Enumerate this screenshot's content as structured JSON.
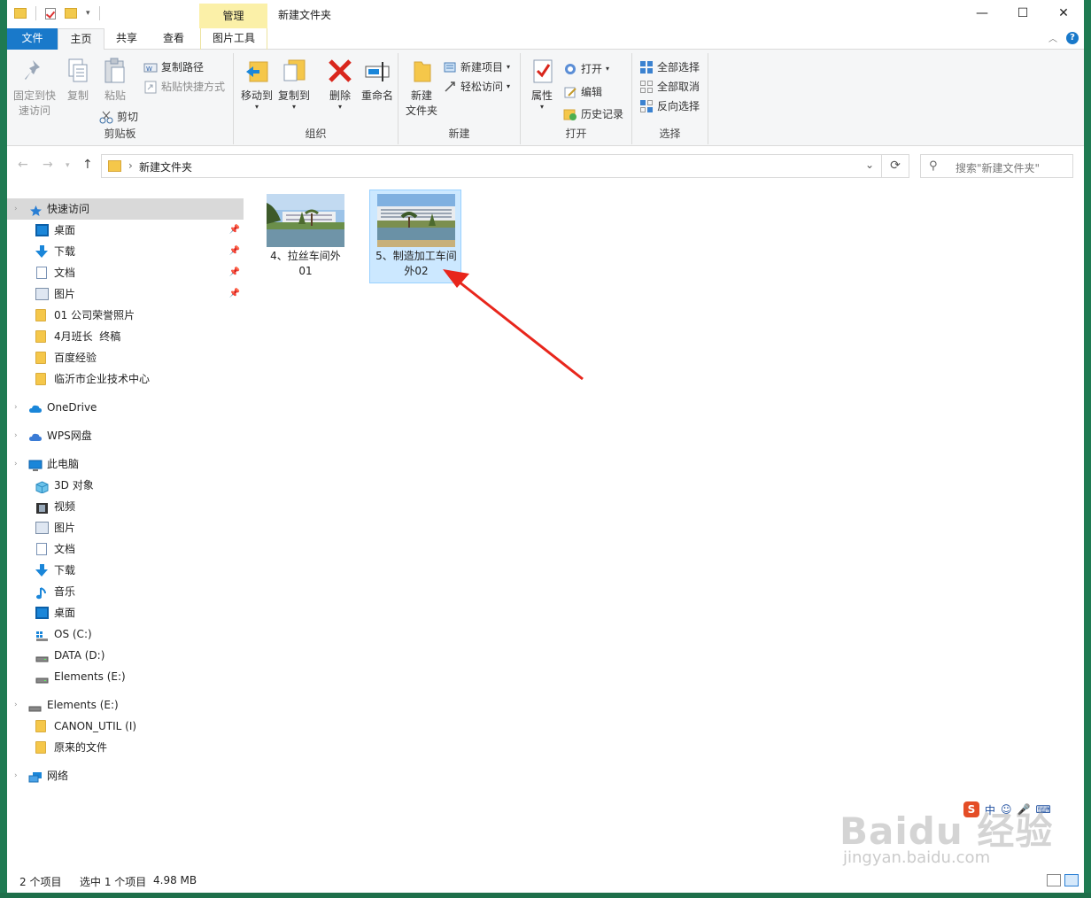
{
  "window": {
    "title": "新建文件夹",
    "contextual_tab_header": "管理",
    "controls": [
      "—",
      "☐",
      "✕"
    ]
  },
  "tabs": {
    "file": "文件",
    "home": "主页",
    "share": "共享",
    "view": "查看",
    "picture_tools": "图片工具"
  },
  "ribbon": {
    "clipboard": {
      "label": "剪贴板",
      "pin_quick_access_line1": "固定到快",
      "pin_quick_access_line2": "速访问",
      "copy": "复制",
      "paste": "粘贴",
      "copy_path": "复制路径",
      "paste_shortcut": "粘贴快捷方式",
      "cut": "剪切"
    },
    "organize": {
      "label": "组织",
      "move_to": "移动到",
      "copy_to": "复制到",
      "delete": "删除",
      "rename": "重命名"
    },
    "new": {
      "label": "新建",
      "new_folder_line1": "新建",
      "new_folder_line2": "文件夹",
      "new_item": "新建项目",
      "easy_access": "轻松访问"
    },
    "open": {
      "label": "打开",
      "properties": "属性",
      "open": "打开",
      "edit": "编辑",
      "history": "历史记录"
    },
    "select": {
      "label": "选择",
      "select_all": "全部选择",
      "select_none": "全部取消",
      "invert": "反向选择"
    }
  },
  "address": {
    "path": "新建文件夹",
    "search_placeholder": "搜索\"新建文件夹\""
  },
  "nav": {
    "quick_access": "快速访问",
    "quick_items": [
      "桌面",
      "下载",
      "文档",
      "图片",
      "01 公司荣誉照片",
      "4月班长  终稿",
      "百度经验",
      "临沂市企业技术中心"
    ],
    "onedrive": "OneDrive",
    "wps": "WPS网盘",
    "this_pc": "此电脑",
    "pc_items": [
      "3D 对象",
      "视频",
      "图片",
      "文档",
      "下载",
      "音乐",
      "桌面",
      "OS (C:)",
      "DATA (D:)",
      "Elements (E:)"
    ],
    "elements": "Elements (E:)",
    "elements_items": [
      "CANON_UTIL (I)",
      "原来的文件"
    ],
    "network": "网络"
  },
  "files": [
    {
      "line1": "4、拉丝车间外",
      "line2": "01",
      "selected": false
    },
    {
      "line1": "5、制造加工车间",
      "line2": "外02",
      "selected": true
    }
  ],
  "status": {
    "count": "2 个项目",
    "selection": "选中 1 个项目",
    "size": "4.98 MB"
  },
  "watermark": {
    "brand": "Baidu 经验",
    "url": "jingyan.baidu.com",
    "ime": "中"
  },
  "colors": {
    "accent": "#1979ca",
    "selection": "#cce8ff",
    "manage_tab": "#fbf0a8",
    "annotation": "#e8261c"
  }
}
